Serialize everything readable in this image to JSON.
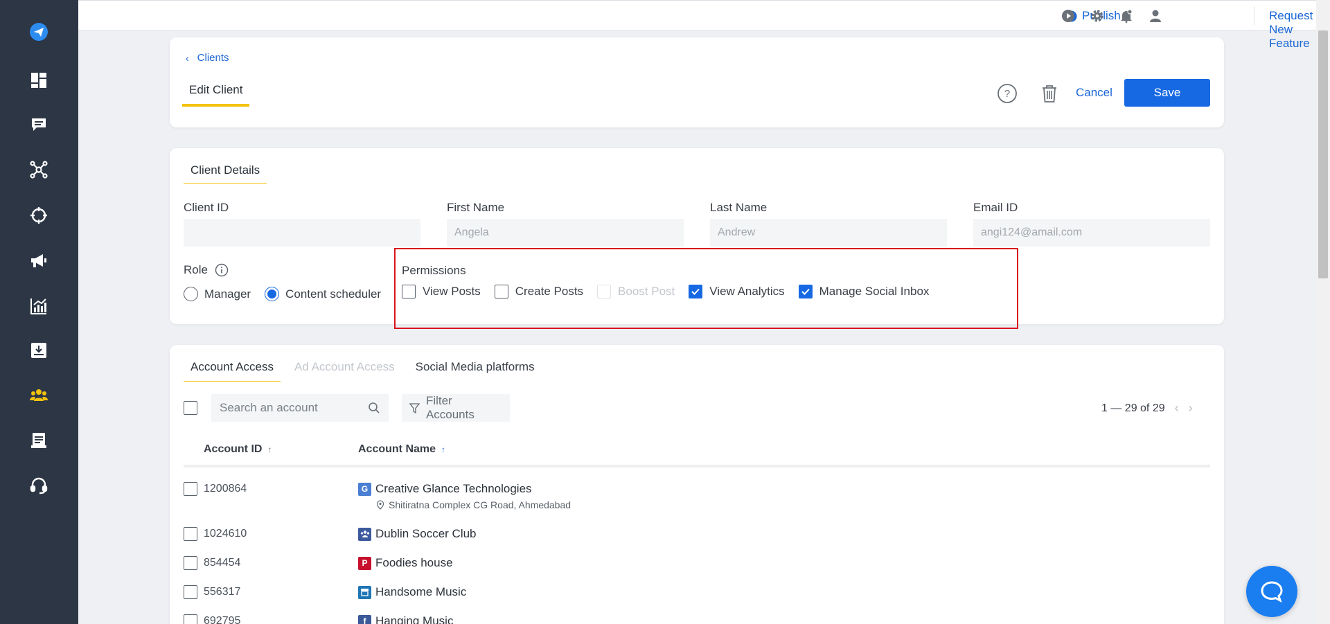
{
  "topbar": {
    "publish_label": "Publish",
    "request_label": "Request New Feature"
  },
  "header": {
    "breadcrumb": "Clients",
    "title": "Edit Client",
    "cancel_label": "Cancel",
    "save_label": "Save"
  },
  "details": {
    "section_title": "Client Details",
    "client_id_label": "Client ID",
    "client_id_value": "",
    "first_name_label": "First Name",
    "first_name_value": "Angela",
    "last_name_label": "Last Name",
    "last_name_value": "Andrew",
    "email_label": "Email ID",
    "email_value": "angi124@amail.com",
    "role_label": "Role",
    "roles": [
      {
        "label": "Manager",
        "selected": false
      },
      {
        "label": "Content scheduler",
        "selected": true
      }
    ],
    "permissions_title": "Permissions",
    "permissions": [
      {
        "label": "View Posts",
        "checked": false,
        "disabled": false
      },
      {
        "label": "Create Posts",
        "checked": false,
        "disabled": false
      },
      {
        "label": "Boost Post",
        "checked": false,
        "disabled": true
      },
      {
        "label": "View Analytics",
        "checked": true,
        "disabled": false
      },
      {
        "label": "Manage Social Inbox",
        "checked": true,
        "disabled": false
      }
    ]
  },
  "access": {
    "tabs": [
      {
        "label": "Account Access",
        "state": "active"
      },
      {
        "label": "Ad Account Access",
        "state": "disabled"
      },
      {
        "label": "Social Media platforms",
        "state": "normal"
      }
    ],
    "search_placeholder": "Search an account",
    "filter_label": "Filter Accounts",
    "pagination": "1 — 29 of 29",
    "col_account_id": "Account ID",
    "col_account_name": "Account Name",
    "rows": [
      {
        "id": "1200864",
        "name": "Creative Glance Technologies",
        "address": "Shitiratna Complex CG Road, Ahmedabad",
        "platform": "google-business-icon",
        "color": "#4a7fd4"
      },
      {
        "id": "1024610",
        "name": "Dublin Soccer Club",
        "platform": "group-icon",
        "color": "#3d5a9e"
      },
      {
        "id": "854454",
        "name": "Foodies house",
        "platform": "pinterest-icon",
        "color": "#c8102e"
      },
      {
        "id": "556317",
        "name": "Handsome Music",
        "platform": "store-icon",
        "color": "#1f76b5"
      },
      {
        "id": "692795",
        "name": "Hanging Music",
        "platform": "facebook-icon",
        "color": "#3b5998"
      }
    ]
  },
  "colors": {
    "sidebar": "#2c3645",
    "primary": "#1769e3",
    "accent_yellow": "#f3c20f",
    "highlight_red": "#d9121b"
  }
}
